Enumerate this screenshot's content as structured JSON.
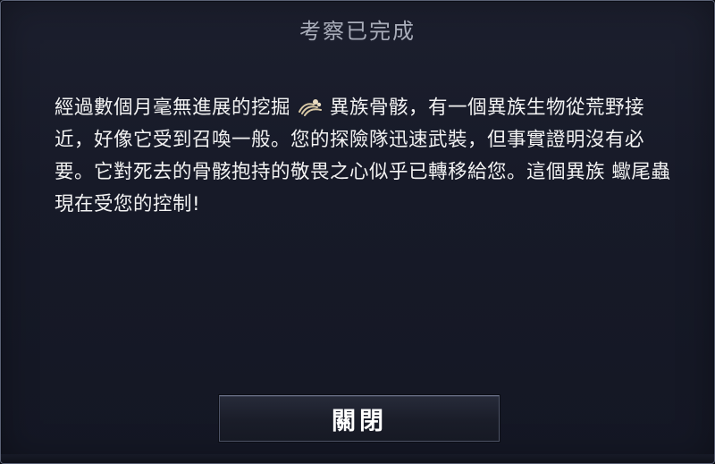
{
  "dialog": {
    "title": "考察已完成",
    "body_part1": "經過數個月毫無進展的挖掘",
    "bone_icon": "fossil-bone-icon",
    "body_part2": "異族骨骸，有一個異族生物從荒野接近，好像它受到召喚一般。您的探險隊迅速武裝，但事實證明沒有必要。它對死去的骨骸抱持的敬畏之心似乎已轉移給您。這個異族 蠍尾蟲 現在受您的控制!",
    "close_label": "關閉"
  },
  "colors": {
    "background": "#171a28",
    "border": "#5b6275",
    "title_text": "#a9adba",
    "body_text": "#f2f2f2",
    "bone_tint": "#d9c9a6"
  }
}
